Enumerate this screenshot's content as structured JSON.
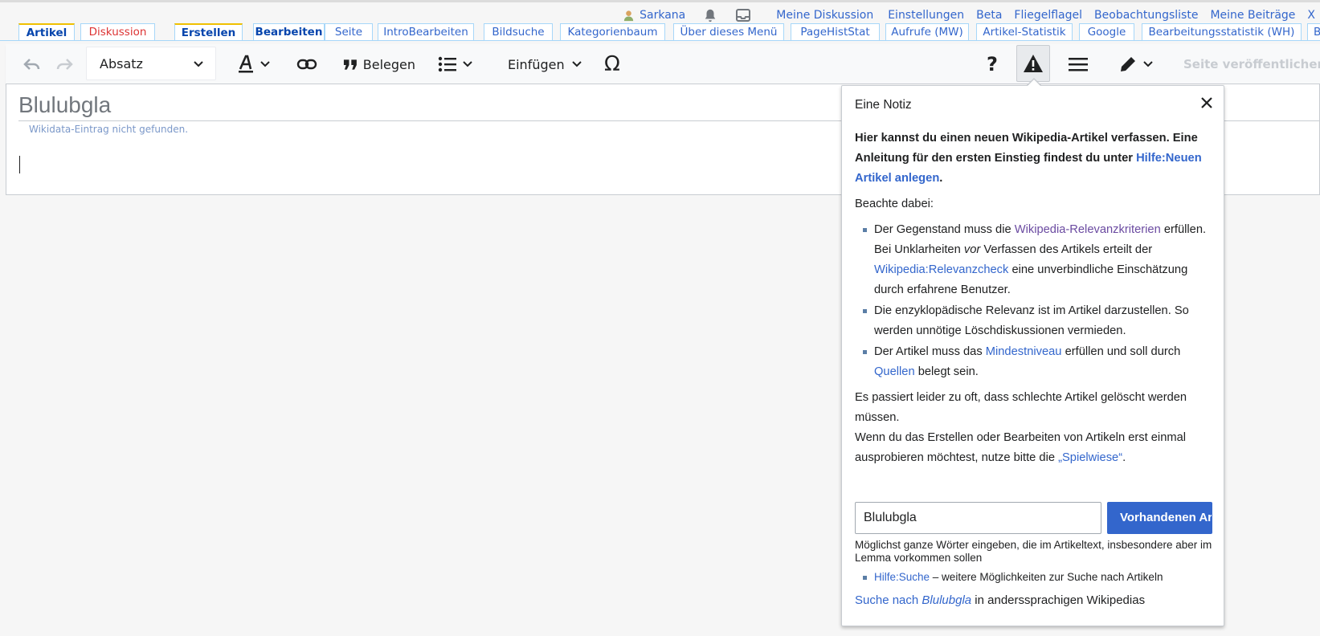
{
  "personal": {
    "username": "Sarkana",
    "links": [
      "Meine Diskussion",
      "Einstellungen",
      "Beta",
      "Fliegelflagel",
      "Beobachtungsliste",
      "Meine Beiträge",
      "X"
    ]
  },
  "tabs": [
    "Artikel",
    "Diskussion",
    "Erstellen",
    "Bearbeiten",
    "Seite",
    "IntroBearbeiten",
    "Bildsuche",
    "Kategorienbaum",
    "Über dieses Menü",
    "PageHistStat",
    "Aufrufe (MW)",
    "Artikel-Statistik",
    "Google",
    "Bearbeitungsstatistik (WH)",
    "B"
  ],
  "toolbar": {
    "paragraph": "Absatz",
    "cite": "Belegen",
    "insert": "Einfügen",
    "publish": "Seite veröffentlichen …"
  },
  "editor": {
    "title": "Blulubgla",
    "wikidata_note": "Wikidata-Eintrag nicht gefunden."
  },
  "notice": {
    "heading": "Eine Notiz",
    "intro_text": "Hier kannst du einen neuen Wikipedia-Artikel verfassen. Eine Anleitung für den ersten Einstieg findest du unter ",
    "intro_link": "Hilfe:Neuen Artikel anlegen",
    "intro_end": ".",
    "note": "Beachte dabei:",
    "b1_a": "Der Gegenstand muss die ",
    "b1_link": "Wikipedia-Relevanzkriterien",
    "b1_b": " erfüllen. Bei Unklarheiten ",
    "b1_em": "vor",
    "b1_c": " Verfassen des Artikels erteilt der ",
    "b1_link2": "Wikipedia:Relevanzcheck",
    "b1_d": " eine unverbindliche Einschätzung durch erfahrene Benutzer.",
    "b2": "Die enzyklopädische Relevanz ist im Artikel darzustellen. So werden unnötige Löschdiskussionen vermieden.",
    "b3_a": "Der Artikel muss das ",
    "b3_link": "Mindestniveau",
    "b3_b": " erfüllen und soll durch ",
    "b3_link2": "Quellen",
    "b3_c": " belegt sein.",
    "p3": "Es passiert leider zu oft, dass schlechte Artikel gelöscht werden müssen.",
    "p4_a": "Wenn du das Erstellen oder Bearbeiten von Artikeln erst einmal ausprobieren möchtest, nutze bitte die ",
    "p4_q1": "„",
    "p4_link": "Spielwiese",
    "p4_q2": "“",
    "p4_end": ".",
    "search_value": "Blulubgla",
    "search_button": "Vorhandenen Artikel suchen",
    "hint": "Möglichst ganze Wörter eingeben, die im Artikeltext, insbesondere aber im Lemma vorkommen sollen",
    "help_link": "Hilfe:Suche",
    "help_text": " – weitere Möglichkeiten zur Suche nach Artikeln",
    "other_a": "Suche nach ",
    "other_em": "Blulubgla",
    "other_b": " in anderssprachigen Wikipedias"
  }
}
